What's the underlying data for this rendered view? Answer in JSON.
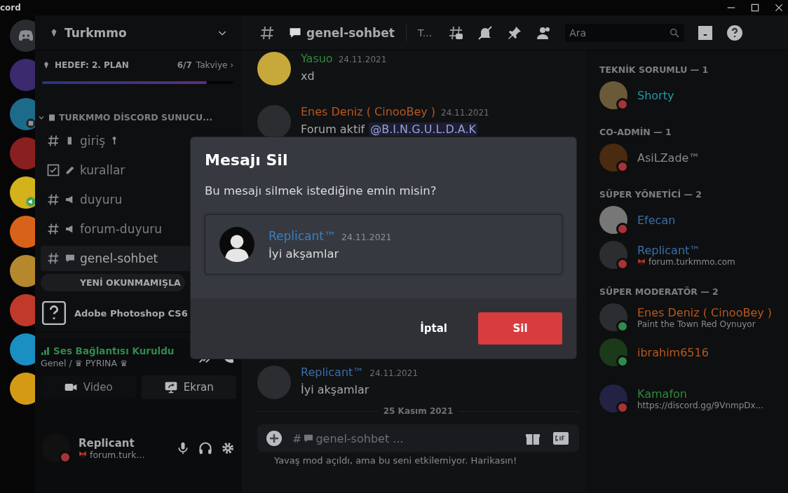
{
  "window": {
    "title": "cord"
  },
  "server": {
    "name": "Turkmmo",
    "boost": {
      "goal": "HEDEF: 2. PLAN",
      "count": "6/7",
      "label": "Takviye ›",
      "level": 0.86
    }
  },
  "category": {
    "name": "TURKMMO DİSCORD SUNUCU...",
    "expanded": true
  },
  "channels": [
    {
      "kind": "text",
      "name": "giriş",
      "selected": false
    },
    {
      "kind": "rules",
      "name": "kurallar",
      "selected": false
    },
    {
      "kind": "text",
      "name": "duyuru",
      "selected": false
    },
    {
      "kind": "text",
      "name": "forum-duyuru",
      "selected": false
    },
    {
      "kind": "text",
      "name": "genel-sohbet",
      "selected": true
    }
  ],
  "unread_pill": "YENİ OKUNMAMIŞLA",
  "activity": {
    "name": "Adobe Photoshop CS6"
  },
  "voice": {
    "status": "Ses Bağlantısı Kuruldu",
    "location": "Genel / ♛ PYRINA ♛",
    "buttons": [
      {
        "kind": "video",
        "label": "Video"
      },
      {
        "kind": "screen",
        "label": "Ekran"
      }
    ]
  },
  "user": {
    "name": "Replicant",
    "status_text": "forum.turk...",
    "status": {
      "color": "#a83236"
    }
  },
  "chat": {
    "channel": "genel-sohbet",
    "topic": "T...",
    "search": {
      "placeholder": "Ara"
    },
    "messages": [
      {
        "author": "Yasuo",
        "color": "#2f8a3c",
        "time": "24.11.2021",
        "text": "xd"
      },
      {
        "author": "Enes Deniz ( CinooBey )",
        "color": "#b8581e",
        "time": "24.11.2021",
        "text": "Forum aktif",
        "mention": "@B.I.N.G.U.L.D.A.K"
      },
      {
        "author": "Replicant™",
        "color": "#3b6ea8",
        "time": "24.11.2021",
        "text": "İyi akşamlar"
      }
    ],
    "divider": "25 Kasım 2021",
    "composer": {
      "prefix": "#",
      "placeholder": "genel-sohbet ..."
    },
    "slowmode": "Yavaş mod açıldı, ama bu seni etkilemiyor. Harikasın!"
  },
  "members": [
    {
      "title": "TEKNİK SORUMLU — 1",
      "items": [
        {
          "name": "Shorty",
          "color": "#1f9aa6",
          "status": {
            "color": "#a83236"
          }
        }
      ]
    },
    {
      "title": "CO-ADMİN — 1",
      "items": [
        {
          "name": "AsiLZade™",
          "color": "#8a8a8a",
          "status": {
            "color": "#a83236"
          }
        }
      ]
    },
    {
      "title": "SÜPER YÖNETİCİ — 2",
      "items": [
        {
          "name": "Efecan",
          "color": "#3b6ea8",
          "status": {
            "color": "#a83236"
          }
        },
        {
          "name": "Replicant™",
          "color": "#3b6ea8",
          "status": {
            "color": "#a83236"
          },
          "activity": "forum.turkmmo.com"
        }
      ]
    },
    {
      "title": "SÜPER MODERATÖR — 2",
      "items": [
        {
          "name": "Enes Deniz ( CinooBey )",
          "color": "#b8581e",
          "status": {
            "color": "#2f8a4c"
          },
          "activity": "Paint the Town Red Oynuyor"
        },
        {
          "name": "ibrahim6516",
          "color": "#b8581e",
          "status": {
            "color": "#2f8a4c"
          }
        }
      ]
    },
    {
      "items": [
        {
          "name": "Kamafon",
          "color": "#2f8a3c",
          "status": {
            "color": "#a83236"
          },
          "activity": "https://discord.gg/9VnmpDx..."
        }
      ]
    }
  ],
  "modal": {
    "title": "Mesajı Sil",
    "text": "Bu mesajı silmek istediğine emin misin?",
    "preview": {
      "author": "Replicant™",
      "time": "24.11.2021",
      "text": "İyi akşamlar"
    },
    "buttons": [
      {
        "kind": "cancel",
        "label": "İptal"
      },
      {
        "kind": "danger",
        "label": "Sil"
      }
    ]
  }
}
